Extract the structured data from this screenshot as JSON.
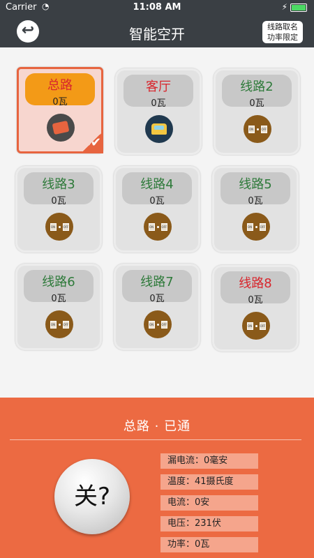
{
  "status_bar": {
    "carrier": "Carrier",
    "time": "11:08 AM",
    "battery_level": 1.0
  },
  "nav": {
    "title": "智能空开",
    "action_line1": "线路取名",
    "action_line2": "功率限定"
  },
  "cards": [
    {
      "name": "总路",
      "power": "0瓦",
      "name_color": "red",
      "icon": "breaker-icon",
      "selected": true
    },
    {
      "name": "客厅",
      "power": "0瓦",
      "name_color": "red",
      "icon": "sofa-icon",
      "selected": false
    },
    {
      "name": "线路2",
      "power": "0瓦",
      "name_color": "green",
      "icon": "switch-icon",
      "selected": false
    },
    {
      "name": "线路3",
      "power": "0瓦",
      "name_color": "green",
      "icon": "switch-icon",
      "selected": false
    },
    {
      "name": "线路4",
      "power": "0瓦",
      "name_color": "green",
      "icon": "switch-icon",
      "selected": false
    },
    {
      "name": "线路5",
      "power": "0瓦",
      "name_color": "green",
      "icon": "switch-icon",
      "selected": false
    },
    {
      "name": "线路6",
      "power": "0瓦",
      "name_color": "green",
      "icon": "switch-icon",
      "selected": false
    },
    {
      "name": "线路7",
      "power": "0瓦",
      "name_color": "green",
      "icon": "switch-icon",
      "selected": false
    },
    {
      "name": "线路8",
      "power": "0瓦",
      "name_color": "red",
      "icon": "switch-icon",
      "selected": false
    }
  ],
  "switch_icon_labels": {
    "on": "ON",
    "off": "OFF"
  },
  "panel": {
    "title": "总路 · 已通",
    "button_label": "关?",
    "readings": [
      "漏电流：0毫安",
      "温度：41摄氏度",
      "电流：0安",
      "电压：231伏",
      "功率：0瓦"
    ]
  },
  "colors": {
    "accent": "#ec6a42",
    "header_dark": "#3a3f44",
    "selected_header": "#f39a17"
  }
}
